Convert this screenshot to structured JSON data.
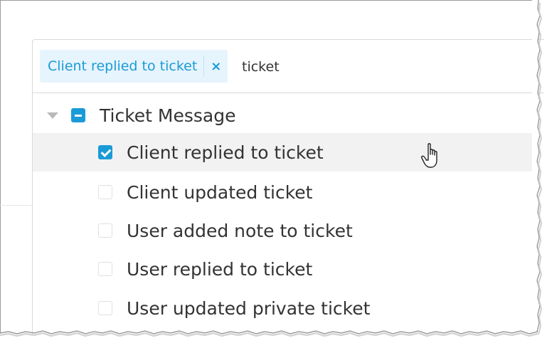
{
  "selector": {
    "selected_tag": "Client replied to ticket",
    "tag_remove": "×",
    "search_value": "ticket"
  },
  "tree": {
    "group_label": "Ticket Message",
    "group_state": "indeterminate",
    "items": [
      {
        "label": "Client replied to ticket",
        "checked": true,
        "hovered": true
      },
      {
        "label": "Client updated ticket",
        "checked": false
      },
      {
        "label": "User added note to ticket",
        "checked": false
      },
      {
        "label": "User replied to ticket",
        "checked": false
      },
      {
        "label": "User updated private ticket",
        "checked": false
      }
    ]
  },
  "colors": {
    "accent": "#1a9bd7",
    "tag_background": "#e6f4fd",
    "hover_background": "#f2f2f2",
    "text": "#333333"
  },
  "icons": {
    "caret": "caret-down-icon",
    "tag_remove": "close-icon",
    "cursor": "hand-pointer-icon"
  }
}
